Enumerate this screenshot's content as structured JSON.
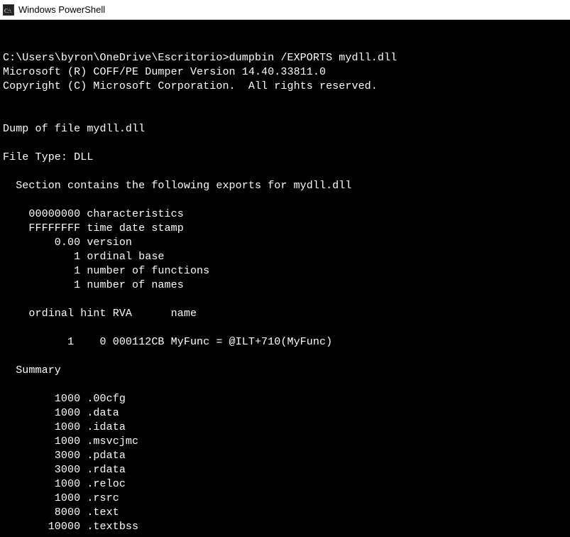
{
  "titlebar": {
    "title": "Windows PowerShell"
  },
  "prompt": {
    "path": "C:\\Users\\byron\\OneDrive\\Escritorio>",
    "command": "dumpbin /EXPORTS mydll.dll"
  },
  "header": {
    "line1": "Microsoft (R) COFF/PE Dumper Version 14.40.33811.0",
    "line2": "Copyright (C) Microsoft Corporation.  All rights reserved."
  },
  "dump": {
    "dumpOf": "Dump of file mydll.dll",
    "fileType": "File Type: DLL",
    "sectionLine": "  Section contains the following exports for mydll.dll",
    "meta": {
      "characteristics": "    00000000 characteristics",
      "timeDateStamp": "    FFFFFFFF time date stamp",
      "version": "        0.00 version",
      "ordinalBase": "           1 ordinal base",
      "numFunctions": "           1 number of functions",
      "numNames": "           1 number of names"
    },
    "tableHeader": "    ordinal hint RVA      name",
    "exportRow": "          1    0 000112CB MyFunc = @ILT+710(MyFunc)",
    "summaryLabel": "  Summary",
    "summary": [
      "        1000 .00cfg",
      "        1000 .data",
      "        1000 .idata",
      "        1000 .msvcjmc",
      "        3000 .pdata",
      "        3000 .rdata",
      "        1000 .reloc",
      "        1000 .rsrc",
      "        8000 .text",
      "       10000 .textbss"
    ]
  }
}
